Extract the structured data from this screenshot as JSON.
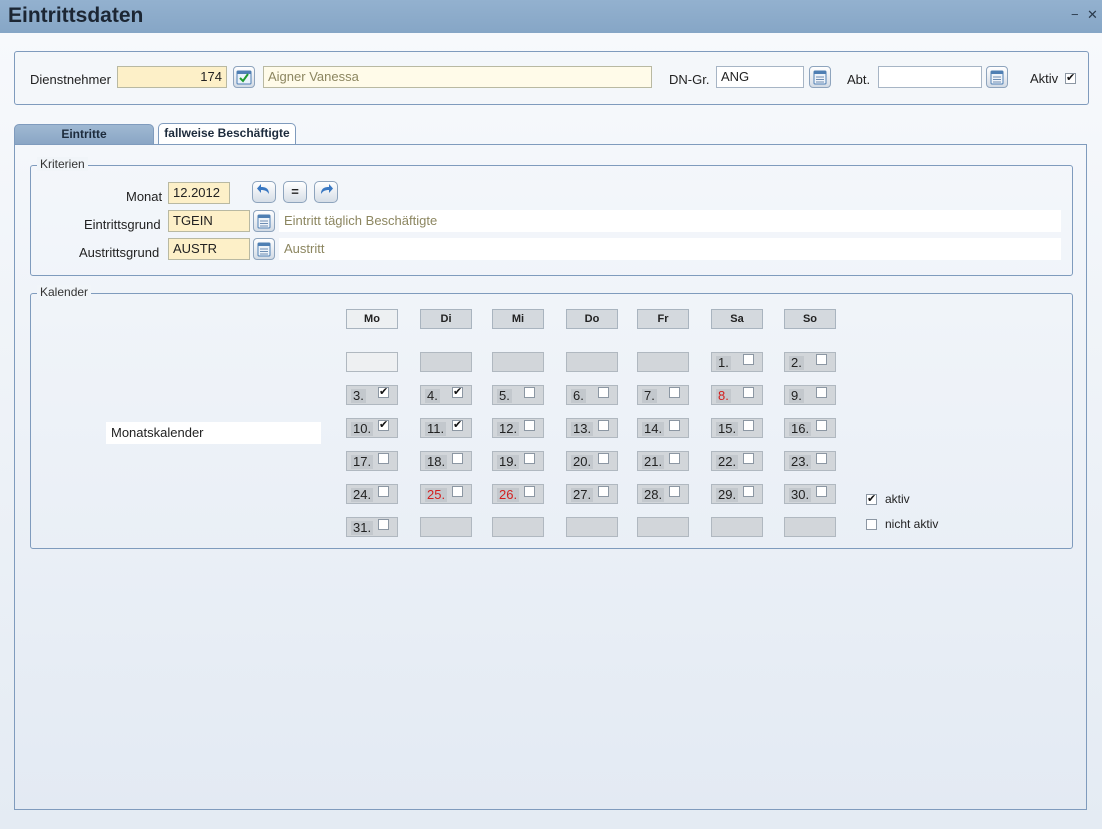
{
  "window": {
    "title": "Eintrittsdaten"
  },
  "header": {
    "employee_label": "Dienstnehmer",
    "employee_number": "174",
    "employee_name": "Aigner Vanessa",
    "group_label": "DN-Gr.",
    "group_value": "ANG",
    "department_label": "Abt.",
    "department_value": "",
    "active_label": "Aktiv",
    "active_checked": "✔"
  },
  "tabs": [
    {
      "label": "Eintritte"
    },
    {
      "label": "fallweise Beschäftigte"
    }
  ],
  "criteria": {
    "legend": "Kriterien",
    "month_label": "Monat",
    "month_value": "12.2012",
    "equals_label": "=",
    "entry_reason_label": "Eintrittsgrund",
    "entry_reason_code": "TGEIN",
    "entry_reason_text": "Eintritt täglich Beschäftigte",
    "exit_reason_label": "Austrittsgrund",
    "exit_reason_code": "AUSTR",
    "exit_reason_text": "Austritt"
  },
  "calendar": {
    "legend": "Kalender",
    "month_calendar_label": "Monatskalender",
    "weekdays": [
      "Mo",
      "Di",
      "Mi",
      "Do",
      "Fr",
      "Sa",
      "So"
    ],
    "days": [
      {
        "num": "1.",
        "checked": false,
        "holiday": false
      },
      {
        "num": "2.",
        "checked": false,
        "holiday": false
      },
      {
        "num": "3.",
        "checked": true,
        "holiday": false
      },
      {
        "num": "4.",
        "checked": true,
        "holiday": false
      },
      {
        "num": "5.",
        "checked": false,
        "holiday": false
      },
      {
        "num": "6.",
        "checked": false,
        "holiday": false
      },
      {
        "num": "7.",
        "checked": false,
        "holiday": false
      },
      {
        "num": "8.",
        "checked": false,
        "holiday": true
      },
      {
        "num": "9.",
        "checked": false,
        "holiday": false
      },
      {
        "num": "10.",
        "checked": true,
        "holiday": false
      },
      {
        "num": "11.",
        "checked": true,
        "holiday": false
      },
      {
        "num": "12.",
        "checked": false,
        "holiday": false
      },
      {
        "num": "13.",
        "checked": false,
        "holiday": false
      },
      {
        "num": "14.",
        "checked": false,
        "holiday": false
      },
      {
        "num": "15.",
        "checked": false,
        "holiday": false
      },
      {
        "num": "16.",
        "checked": false,
        "holiday": false
      },
      {
        "num": "17.",
        "checked": false,
        "holiday": false
      },
      {
        "num": "18.",
        "checked": false,
        "holiday": false
      },
      {
        "num": "19.",
        "checked": false,
        "holiday": false
      },
      {
        "num": "20.",
        "checked": false,
        "holiday": false
      },
      {
        "num": "21.",
        "checked": false,
        "holiday": false
      },
      {
        "num": "22.",
        "checked": false,
        "holiday": false
      },
      {
        "num": "23.",
        "checked": false,
        "holiday": false
      },
      {
        "num": "24.",
        "checked": false,
        "holiday": false
      },
      {
        "num": "25.",
        "checked": false,
        "holiday": true
      },
      {
        "num": "26.",
        "checked": false,
        "holiday": true
      },
      {
        "num": "27.",
        "checked": false,
        "holiday": false
      },
      {
        "num": "28.",
        "checked": false,
        "holiday": false
      },
      {
        "num": "29.",
        "checked": false,
        "holiday": false
      },
      {
        "num": "30.",
        "checked": false,
        "holiday": false
      },
      {
        "num": "31.",
        "checked": false,
        "holiday": false
      }
    ],
    "legend_items": [
      {
        "label": "aktiv",
        "mark": "✔"
      },
      {
        "label": "nicht aktiv",
        "mark": ""
      }
    ]
  },
  "colors": {
    "holiday": "#d31f1f",
    "titlebar": "#8fadcc",
    "border": "#7f9bbd"
  },
  "icons": {
    "lookup": "calendar-list-icon",
    "confirm": "checkmark-icon",
    "prev": "arrow-back-icon",
    "next": "arrow-forward-icon",
    "minimize": "minimize-icon",
    "close": "close-icon"
  }
}
